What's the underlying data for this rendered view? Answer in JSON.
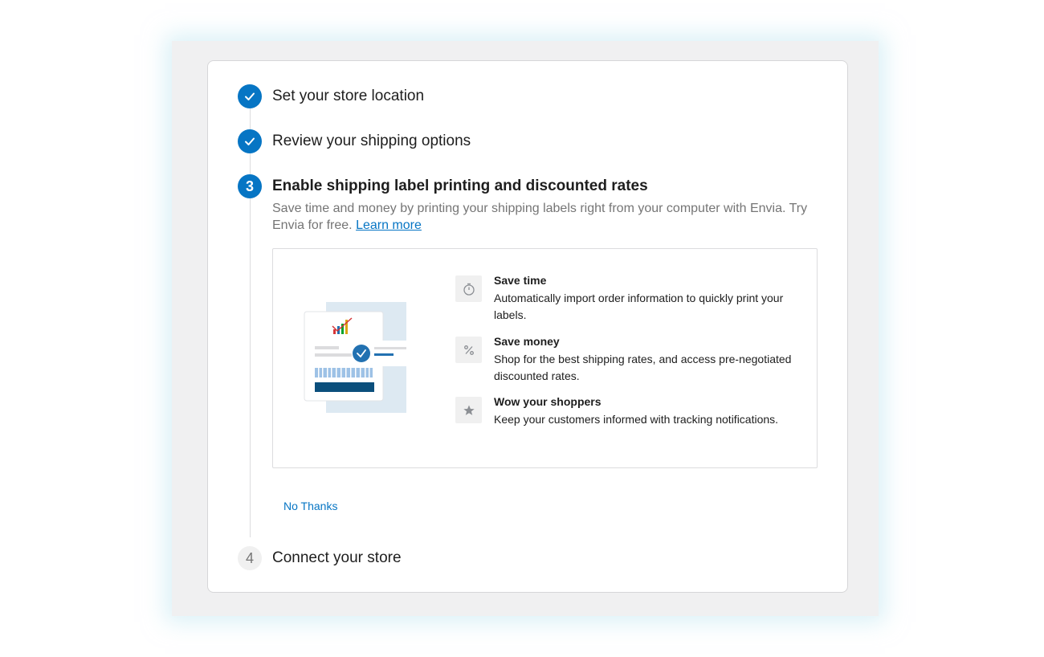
{
  "steps": [
    {
      "number": "1",
      "title": "Set your store location",
      "status": "complete"
    },
    {
      "number": "2",
      "title": "Review your shipping options",
      "status": "complete"
    },
    {
      "number": "3",
      "title": "Enable shipping label printing and discounted rates",
      "status": "active",
      "description": "Save time and money by printing your shipping labels right from your computer with Envia. Try Envia for free.",
      "learn_more": "Learn more",
      "features": [
        {
          "icon": "stopwatch-icon",
          "title": "Save time",
          "description": "Automatically import order information to quickly print your labels."
        },
        {
          "icon": "percent-icon",
          "title": "Save money",
          "description": "Shop for the best shipping rates, and access pre-negotiated discounted rates."
        },
        {
          "icon": "star-icon",
          "title": "Wow your shoppers",
          "description": "Keep your customers informed with tracking notifications."
        }
      ],
      "dismiss_label": "No Thanks"
    },
    {
      "number": "4",
      "title": "Connect your store",
      "status": "pending"
    }
  ],
  "colors": {
    "accent": "#0675c4",
    "text": "#1e1e1e",
    "muted": "#757575",
    "border": "#dcdcde",
    "illustration_bg": "#dde9f2",
    "label_bar": "#0b4f7c"
  }
}
